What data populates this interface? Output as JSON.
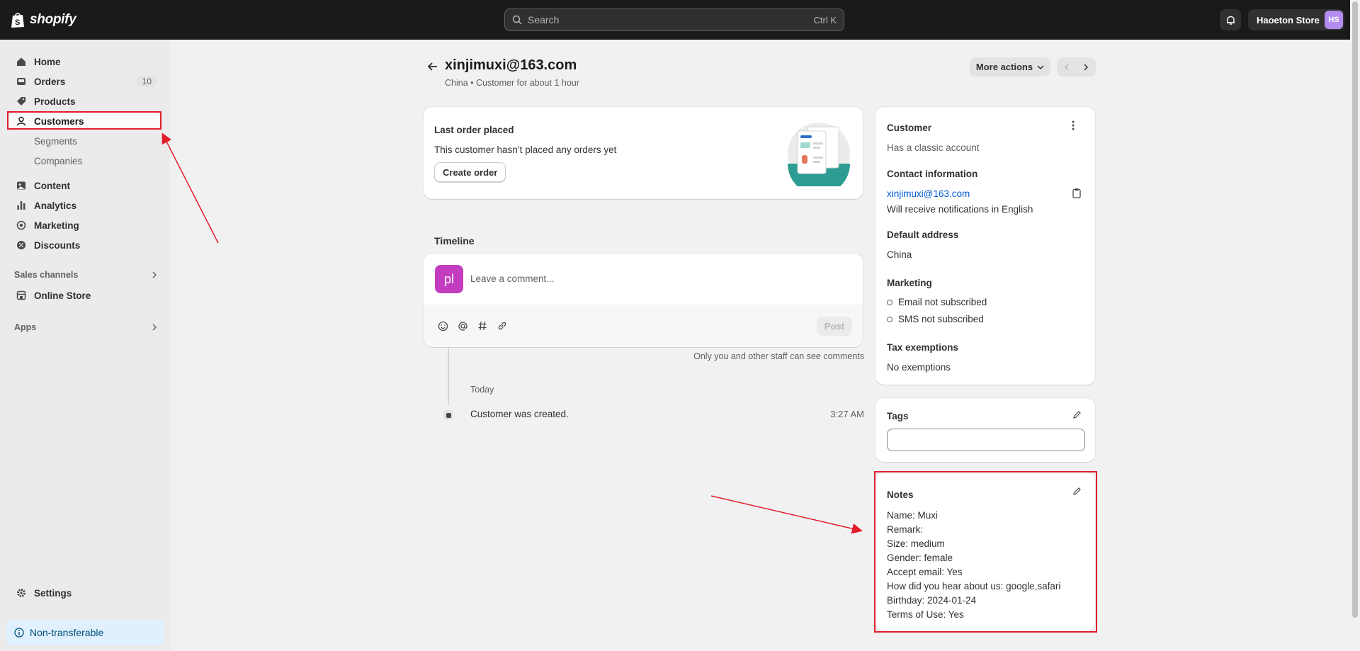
{
  "topbar": {
    "logo_text": "shopify",
    "search_placeholder": "Search",
    "search_shortcut": "Ctrl K",
    "store_name": "Haoeton Store",
    "store_initials": "HS"
  },
  "sidebar": {
    "items": [
      {
        "label": "Home",
        "icon": "home-icon"
      },
      {
        "label": "Orders",
        "icon": "inbox-icon",
        "badge": "10"
      },
      {
        "label": "Products",
        "icon": "tag-icon"
      },
      {
        "label": "Customers",
        "icon": "person-icon"
      },
      {
        "label": "Segments"
      },
      {
        "label": "Companies"
      },
      {
        "label": "Content",
        "icon": "content-icon"
      },
      {
        "label": "Analytics",
        "icon": "bar-chart-icon"
      },
      {
        "label": "Marketing",
        "icon": "target-icon"
      },
      {
        "label": "Discounts",
        "icon": "discount-icon"
      }
    ],
    "sales_channels_label": "Sales channels",
    "online_store_label": "Online Store",
    "apps_label": "Apps",
    "settings_label": "Settings",
    "non_transferable_label": "Non-transferable"
  },
  "header": {
    "title": "xinjimuxi@163.com",
    "subtitle": "China • Customer for about 1 hour",
    "more_actions_label": "More actions"
  },
  "last_order": {
    "title": "Last order placed",
    "text": "This customer hasn’t placed any orders yet",
    "button_label": "Create order"
  },
  "timeline": {
    "heading": "Timeline",
    "avatar_initials": "pl",
    "comment_placeholder": "Leave a comment...",
    "post_label": "Post",
    "staff_note": "Only you and other staff can see comments",
    "day_label": "Today",
    "event_text": "Customer was created.",
    "event_time": "3:27 AM"
  },
  "customer": {
    "title": "Customer",
    "account_type": "Has a classic account",
    "contact_heading": "Contact information",
    "email": "xinjimuxi@163.com",
    "language_note": "Will receive notifications in English",
    "address_heading": "Default address",
    "address": "China",
    "marketing_heading": "Marketing",
    "email_marketing": "Email not subscribed",
    "sms_marketing": "SMS not subscribed",
    "tax_heading": "Tax exemptions",
    "tax_value": "No exemptions"
  },
  "tags": {
    "title": "Tags",
    "input_value": ""
  },
  "notes": {
    "title": "Notes",
    "lines": [
      "Name: Muxi",
      "Remark:",
      "Size: medium",
      "Gender: female",
      "Accept email: Yes",
      "How did you hear about us: google,safari",
      "Birthday: 2024-01-24",
      "Terms of Use: Yes"
    ]
  },
  "colors": {
    "topbar": "#1a1a1a",
    "highlight_red": "#e31c2d",
    "link_blue": "#005bd3",
    "avatar_purple": "#c43cbf",
    "store_avatar": "#b28cf0"
  }
}
